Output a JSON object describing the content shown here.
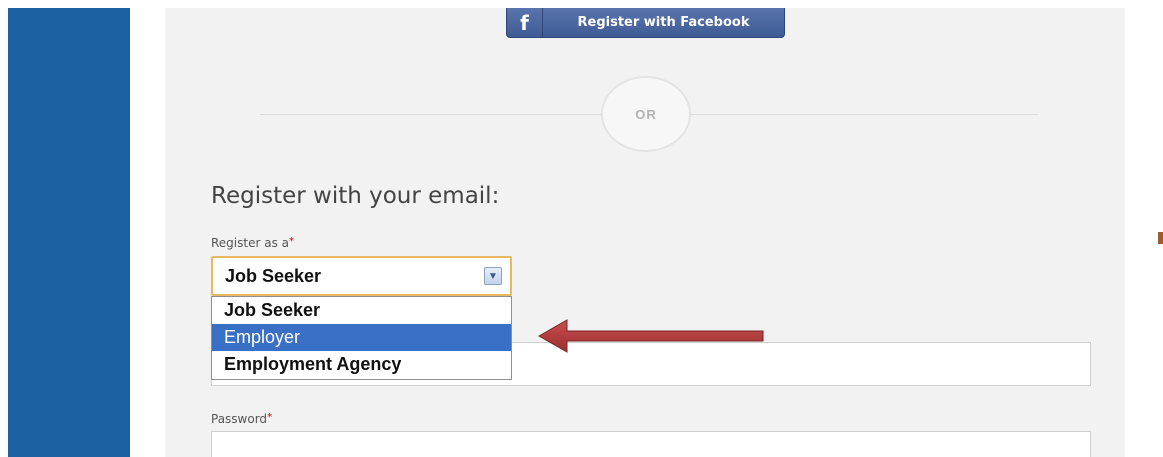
{
  "facebook": {
    "label": "Register with Facebook",
    "icon": "f"
  },
  "divider": {
    "text": "OR"
  },
  "form": {
    "heading": "Register with your email:",
    "register_as_label": "Register as a",
    "required_mark": "*",
    "selected_value": "Job Seeker",
    "options": [
      "Job Seeker",
      "Employer",
      "Employment Agency"
    ],
    "highlighted_option": "Employer",
    "password_label": "Password"
  },
  "colors": {
    "sidebar": "#1b62a3",
    "facebook": "#3f5b95",
    "highlight": "#3a6fc6",
    "annotation_arrow": "#b03a3a"
  }
}
